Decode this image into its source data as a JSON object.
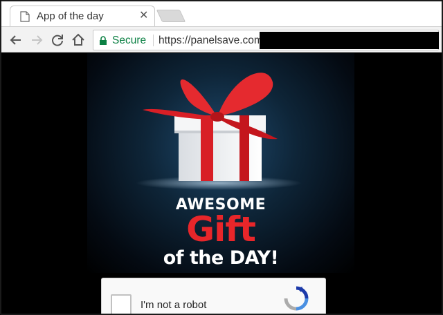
{
  "tab": {
    "title": "App of the day",
    "favicon": "page-icon"
  },
  "toolbar": {
    "secure_label": "Secure",
    "url": "https://panelsave.com/"
  },
  "banner": {
    "line1": "AWESOME",
    "line2": "Gift",
    "line3": "of the DAY!",
    "colors": {
      "white": "#ffffff",
      "red": "#e8262a"
    }
  },
  "captcha": {
    "label": "I'm not a robot",
    "checked": false
  }
}
